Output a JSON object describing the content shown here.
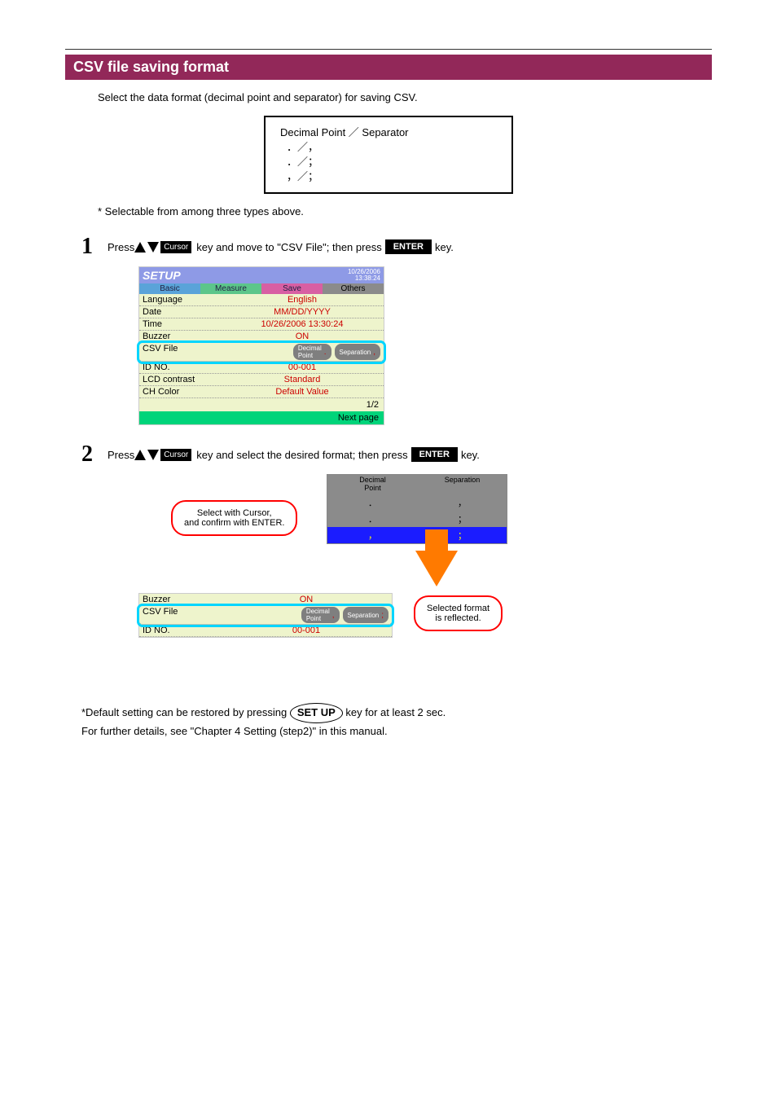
{
  "section_title": "CSV file saving format",
  "intro": "Select the data format (decimal point and separator) for saving CSV.",
  "format_box": {
    "header": "Decimal Point ／ Separator",
    "lines": [
      "．／，",
      "．／；",
      "，／；"
    ]
  },
  "selectable_from": "* Selectable from among three types above.",
  "steps": [
    {
      "num": "1",
      "pre": "Press ",
      "cursor": "Cursor",
      "mid": " key and move to \"CSV File\"; then press ",
      "enter": "ENTER",
      "post": " key."
    },
    {
      "num": "2",
      "pre": "Press ",
      "cursor": "Cursor",
      "mid": " key and select the desired format; then press ",
      "enter": "ENTER",
      "post": " key."
    }
  ],
  "setup_shot": {
    "title": "SETUP",
    "date": "10/26/2006",
    "time": "13:38:24",
    "tabs": {
      "basic": "Basic",
      "measure": "Measure",
      "save": "Save",
      "others": "Others"
    },
    "rows": {
      "language": {
        "label": "Language",
        "value": "English"
      },
      "date": {
        "label": "Date",
        "value": "MM/DD/YYYY"
      },
      "time": {
        "label": "Time",
        "value": "10/26/2006 13:30:24"
      },
      "buzzer": {
        "label": "Buzzer",
        "value": "ON"
      },
      "csv": {
        "label": "CSV File",
        "dec_label": "Decimal\nPoint",
        "dec_val": ".",
        "sep_label": "Separation",
        "sep_val": ","
      },
      "idno": {
        "label": "ID NO.",
        "value": "00-001"
      },
      "lcd": {
        "label": "LCD contrast",
        "value": "Standard"
      },
      "chc": {
        "label": "CH Color",
        "value": "Default Value"
      }
    },
    "page": "1/2",
    "next": "Next page"
  },
  "selgrid": {
    "head_dec": "Decimal\nPoint",
    "head_sep": "Separation",
    "rows": [
      {
        "dec": "．",
        "sep": "，",
        "cls": "g"
      },
      {
        "dec": "．",
        "sep": "；",
        "cls": "g"
      },
      {
        "dec": "，",
        "sep": "；",
        "cls": "b"
      }
    ]
  },
  "callout_left": "Select with Cursor,\nand confirm with ENTER.",
  "callout_right": "Selected format\nis reflected.",
  "mini": {
    "buzzer": {
      "label": "Buzzer",
      "value": "ON"
    },
    "csv": {
      "label": "CSV File",
      "dec_label": "Decimal\nPoint",
      "dec_val": ",",
      "sep_label": "Separation",
      "sep_val": ";"
    },
    "idno": {
      "label": "ID NO.",
      "value": "00-001"
    }
  },
  "footer": {
    "l1_a": "*Default setting can be restored by pressing ",
    "setup_key": "SET UP",
    "l1_b": " key for at least 2 sec.",
    "l2": "For further details, see \"Chapter 4 Setting (step2)\" in this manual."
  }
}
